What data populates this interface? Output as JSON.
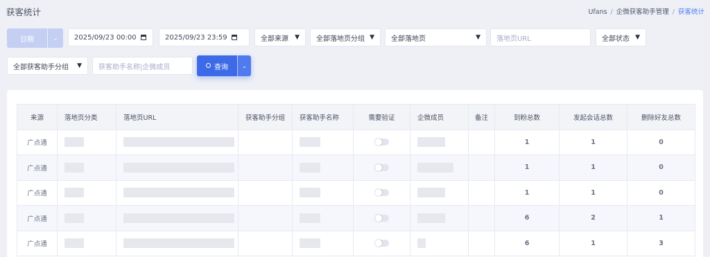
{
  "header": {
    "title": "获客统计",
    "breadcrumb": [
      "Ufans",
      "企微获客助手管理",
      "获客统计"
    ]
  },
  "filters": {
    "date_button": "日期",
    "start_datetime": "2025/09/23 00:00",
    "end_datetime": "2025/09/23 23:59",
    "source_select": "全部来源",
    "landing_group_select": "全部落地页分组",
    "landing_page_select": "全部落地页",
    "landing_url_placeholder": "落地页URL",
    "status_select": "全部状态",
    "assistant_group_select": "全部获客助手分组",
    "assistant_search_placeholder": "获客助手名称|企微成员",
    "query_button": "查询"
  },
  "table": {
    "columns": [
      "来源",
      "落地页分类",
      "落地页URL",
      "获客助手分组",
      "获客助手名称",
      "需要验证",
      "企微成员",
      "备注",
      "到粉总数",
      "发起会话总数",
      "删除好友总数"
    ],
    "rows": [
      {
        "source": "广点通",
        "verify": false,
        "fans": "1",
        "sessions": "1",
        "deleted": "0"
      },
      {
        "source": "广点通",
        "verify": false,
        "fans": "1",
        "sessions": "1",
        "deleted": "0"
      },
      {
        "source": "广点通",
        "verify": false,
        "fans": "1",
        "sessions": "1",
        "deleted": "0"
      },
      {
        "source": "广点通",
        "verify": false,
        "fans": "6",
        "sessions": "2",
        "deleted": "1"
      },
      {
        "source": "广点通",
        "verify": false,
        "fans": "6",
        "sessions": "1",
        "deleted": "3"
      }
    ]
  },
  "colors": {
    "primary": "#3d6be8",
    "primary_disabled": "#c4cff3",
    "page_bg": "#eef0f6",
    "breadcrumb_active": "#4e7df1"
  }
}
